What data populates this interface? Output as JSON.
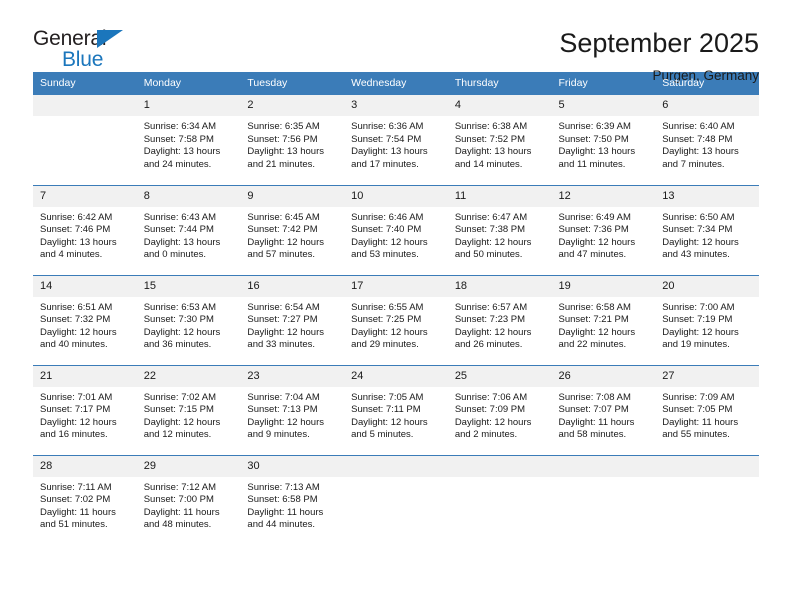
{
  "brand": {
    "name_part1": "General",
    "name_part2": "Blue",
    "accent_color": "#1b76bc"
  },
  "header": {
    "title": "September 2025",
    "subtitle": "Purgen, Germany",
    "header_bg_color": "#3b7cb8",
    "daynum_bg_color": "#f1f1f1"
  },
  "weekdays": [
    "Sunday",
    "Monday",
    "Tuesday",
    "Wednesday",
    "Thursday",
    "Friday",
    "Saturday"
  ],
  "weeks": [
    [
      {
        "day": "",
        "lines": [
          "",
          "",
          "",
          ""
        ]
      },
      {
        "day": "1",
        "lines": [
          "Sunrise: 6:34 AM",
          "Sunset: 7:58 PM",
          "Daylight: 13 hours",
          "and 24 minutes."
        ]
      },
      {
        "day": "2",
        "lines": [
          "Sunrise: 6:35 AM",
          "Sunset: 7:56 PM",
          "Daylight: 13 hours",
          "and 21 minutes."
        ]
      },
      {
        "day": "3",
        "lines": [
          "Sunrise: 6:36 AM",
          "Sunset: 7:54 PM",
          "Daylight: 13 hours",
          "and 17 minutes."
        ]
      },
      {
        "day": "4",
        "lines": [
          "Sunrise: 6:38 AM",
          "Sunset: 7:52 PM",
          "Daylight: 13 hours",
          "and 14 minutes."
        ]
      },
      {
        "day": "5",
        "lines": [
          "Sunrise: 6:39 AM",
          "Sunset: 7:50 PM",
          "Daylight: 13 hours",
          "and 11 minutes."
        ]
      },
      {
        "day": "6",
        "lines": [
          "Sunrise: 6:40 AM",
          "Sunset: 7:48 PM",
          "Daylight: 13 hours",
          "and 7 minutes."
        ]
      }
    ],
    [
      {
        "day": "7",
        "lines": [
          "Sunrise: 6:42 AM",
          "Sunset: 7:46 PM",
          "Daylight: 13 hours",
          "and 4 minutes."
        ]
      },
      {
        "day": "8",
        "lines": [
          "Sunrise: 6:43 AM",
          "Sunset: 7:44 PM",
          "Daylight: 13 hours",
          "and 0 minutes."
        ]
      },
      {
        "day": "9",
        "lines": [
          "Sunrise: 6:45 AM",
          "Sunset: 7:42 PM",
          "Daylight: 12 hours",
          "and 57 minutes."
        ]
      },
      {
        "day": "10",
        "lines": [
          "Sunrise: 6:46 AM",
          "Sunset: 7:40 PM",
          "Daylight: 12 hours",
          "and 53 minutes."
        ]
      },
      {
        "day": "11",
        "lines": [
          "Sunrise: 6:47 AM",
          "Sunset: 7:38 PM",
          "Daylight: 12 hours",
          "and 50 minutes."
        ]
      },
      {
        "day": "12",
        "lines": [
          "Sunrise: 6:49 AM",
          "Sunset: 7:36 PM",
          "Daylight: 12 hours",
          "and 47 minutes."
        ]
      },
      {
        "day": "13",
        "lines": [
          "Sunrise: 6:50 AM",
          "Sunset: 7:34 PM",
          "Daylight: 12 hours",
          "and 43 minutes."
        ]
      }
    ],
    [
      {
        "day": "14",
        "lines": [
          "Sunrise: 6:51 AM",
          "Sunset: 7:32 PM",
          "Daylight: 12 hours",
          "and 40 minutes."
        ]
      },
      {
        "day": "15",
        "lines": [
          "Sunrise: 6:53 AM",
          "Sunset: 7:30 PM",
          "Daylight: 12 hours",
          "and 36 minutes."
        ]
      },
      {
        "day": "16",
        "lines": [
          "Sunrise: 6:54 AM",
          "Sunset: 7:27 PM",
          "Daylight: 12 hours",
          "and 33 minutes."
        ]
      },
      {
        "day": "17",
        "lines": [
          "Sunrise: 6:55 AM",
          "Sunset: 7:25 PM",
          "Daylight: 12 hours",
          "and 29 minutes."
        ]
      },
      {
        "day": "18",
        "lines": [
          "Sunrise: 6:57 AM",
          "Sunset: 7:23 PM",
          "Daylight: 12 hours",
          "and 26 minutes."
        ]
      },
      {
        "day": "19",
        "lines": [
          "Sunrise: 6:58 AM",
          "Sunset: 7:21 PM",
          "Daylight: 12 hours",
          "and 22 minutes."
        ]
      },
      {
        "day": "20",
        "lines": [
          "Sunrise: 7:00 AM",
          "Sunset: 7:19 PM",
          "Daylight: 12 hours",
          "and 19 minutes."
        ]
      }
    ],
    [
      {
        "day": "21",
        "lines": [
          "Sunrise: 7:01 AM",
          "Sunset: 7:17 PM",
          "Daylight: 12 hours",
          "and 16 minutes."
        ]
      },
      {
        "day": "22",
        "lines": [
          "Sunrise: 7:02 AM",
          "Sunset: 7:15 PM",
          "Daylight: 12 hours",
          "and 12 minutes."
        ]
      },
      {
        "day": "23",
        "lines": [
          "Sunrise: 7:04 AM",
          "Sunset: 7:13 PM",
          "Daylight: 12 hours",
          "and 9 minutes."
        ]
      },
      {
        "day": "24",
        "lines": [
          "Sunrise: 7:05 AM",
          "Sunset: 7:11 PM",
          "Daylight: 12 hours",
          "and 5 minutes."
        ]
      },
      {
        "day": "25",
        "lines": [
          "Sunrise: 7:06 AM",
          "Sunset: 7:09 PM",
          "Daylight: 12 hours",
          "and 2 minutes."
        ]
      },
      {
        "day": "26",
        "lines": [
          "Sunrise: 7:08 AM",
          "Sunset: 7:07 PM",
          "Daylight: 11 hours",
          "and 58 minutes."
        ]
      },
      {
        "day": "27",
        "lines": [
          "Sunrise: 7:09 AM",
          "Sunset: 7:05 PM",
          "Daylight: 11 hours",
          "and 55 minutes."
        ]
      }
    ],
    [
      {
        "day": "28",
        "lines": [
          "Sunrise: 7:11 AM",
          "Sunset: 7:02 PM",
          "Daylight: 11 hours",
          "and 51 minutes."
        ]
      },
      {
        "day": "29",
        "lines": [
          "Sunrise: 7:12 AM",
          "Sunset: 7:00 PM",
          "Daylight: 11 hours",
          "and 48 minutes."
        ]
      },
      {
        "day": "30",
        "lines": [
          "Sunrise: 7:13 AM",
          "Sunset: 6:58 PM",
          "Daylight: 11 hours",
          "and 44 minutes."
        ]
      },
      {
        "day": "",
        "lines": [
          "",
          "",
          "",
          ""
        ]
      },
      {
        "day": "",
        "lines": [
          "",
          "",
          "",
          ""
        ]
      },
      {
        "day": "",
        "lines": [
          "",
          "",
          "",
          ""
        ]
      },
      {
        "day": "",
        "lines": [
          "",
          "",
          "",
          ""
        ]
      }
    ]
  ]
}
